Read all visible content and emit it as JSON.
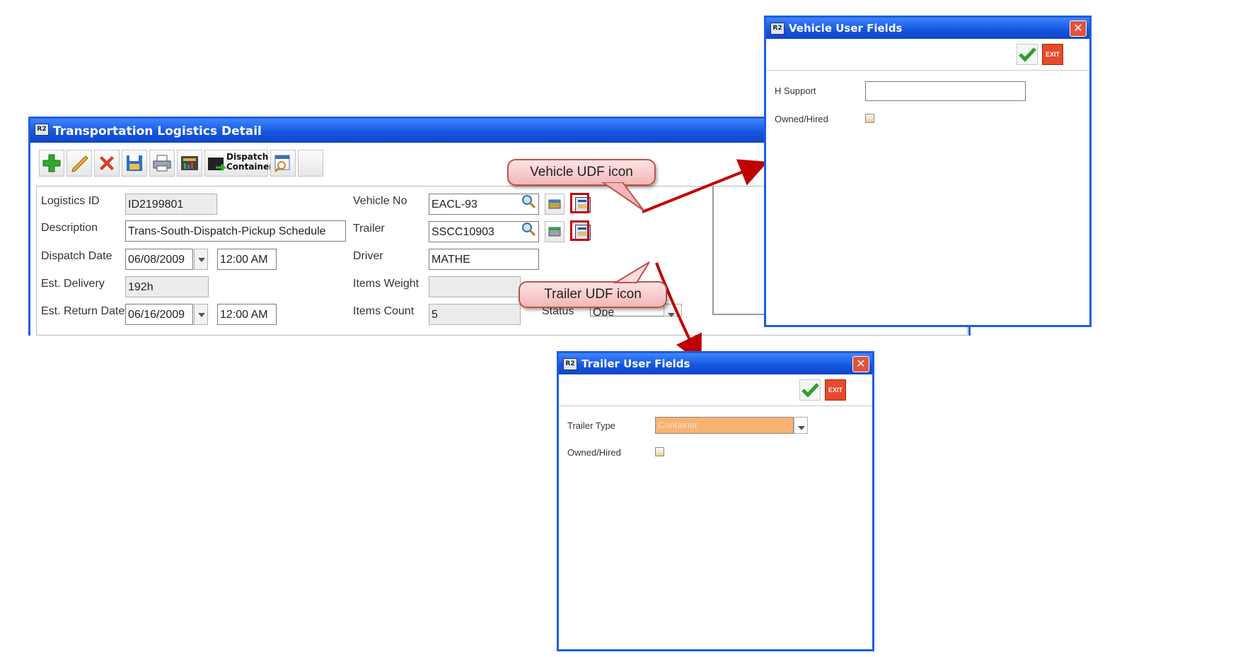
{
  "main_window": {
    "title": "Transportation Logistics Detail",
    "toolbar": {
      "buttons": [
        {
          "name": "add",
          "icon": "plus-icon"
        },
        {
          "name": "edit",
          "icon": "pencil-icon"
        },
        {
          "name": "delete",
          "icon": "x-icon"
        },
        {
          "name": "save",
          "icon": "floppy-icon"
        },
        {
          "name": "print",
          "icon": "printer-icon"
        },
        {
          "name": "report",
          "icon": "chart-icon"
        },
        {
          "name": "dispatch-container",
          "icon": "container-icon",
          "label_line1": "Dispatch",
          "label_line2": "Container"
        },
        {
          "name": "lookup",
          "icon": "calendar-search-icon"
        },
        {
          "name": "blank",
          "icon": ""
        }
      ]
    },
    "form": {
      "logistics_id": {
        "label": "Logistics ID",
        "value": "ID2199801"
      },
      "description": {
        "label": "Description",
        "value": "Trans-South-Dispatch-Pickup Schedule"
      },
      "dispatch_date": {
        "label": "Dispatch Date",
        "date": "06/08/2009",
        "time": "12:00 AM"
      },
      "est_delivery": {
        "label": "Est. Delivery",
        "value": "192h"
      },
      "est_return_date": {
        "label": "Est. Return Date",
        "date": "06/16/2009",
        "time": "12:00 AM"
      },
      "vehicle_no": {
        "label": "Vehicle No",
        "value": "EACL-93"
      },
      "trailer": {
        "label": "Trailer",
        "value": "SSCC10903"
      },
      "driver": {
        "label": "Driver",
        "value": "MATHE"
      },
      "items_weight": {
        "label": "Items Weight",
        "value": ""
      },
      "items_count": {
        "label": "Items Count",
        "value": "5"
      },
      "status": {
        "label": "Status",
        "value": "Ope"
      }
    }
  },
  "callouts": {
    "vehicle": "Vehicle UDF icon",
    "trailer": "Trailer UDF icon"
  },
  "vehicle_dialog": {
    "title": "Vehicle User Fields",
    "exit_label": "EXIT",
    "fields": {
      "h_support": {
        "label": "H Support",
        "value": ""
      },
      "owned_hired": {
        "label": "Owned/Hired"
      }
    }
  },
  "trailer_dialog": {
    "title": "Trailer User Fields",
    "exit_label": "EXIT",
    "fields": {
      "trailer_type": {
        "label": "Trailer Type",
        "value": "Container"
      },
      "owned_hired": {
        "label": "Owned/Hired"
      }
    }
  },
  "colors": {
    "titlebar": "#1656e0",
    "callout_border": "#c0504d",
    "highlight": "#c00000",
    "select_bg": "#f9b270"
  }
}
